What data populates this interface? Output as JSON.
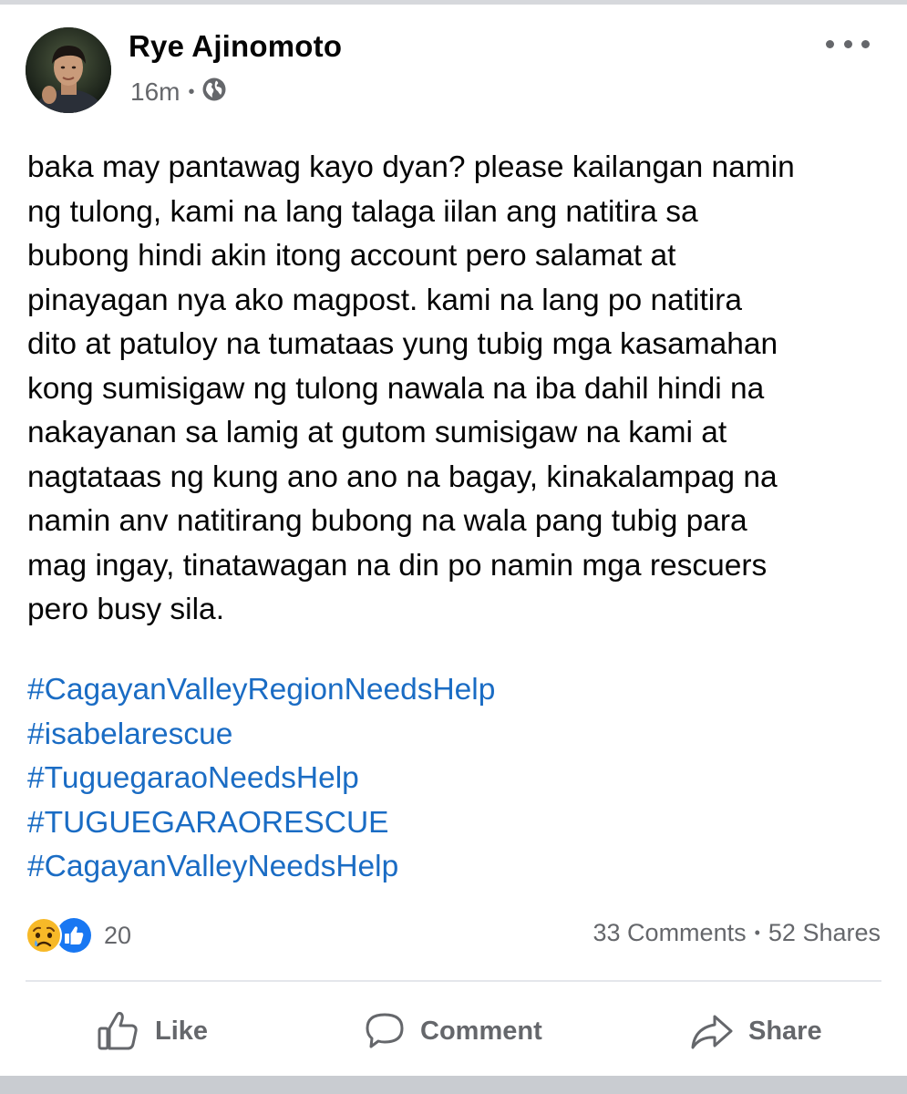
{
  "post": {
    "author": "Rye Ajinomoto",
    "time": "16m",
    "separator": "•",
    "privacy_icon": "globe-icon",
    "text_lines": [
      "baka may pantawag kayo dyan? please kailangan namin",
      "ng tulong, kami na lang talaga iilan ang natitira sa",
      "bubong hindi akin itong account pero salamat at",
      "pinayagan nya ako magpost. kami na lang po natitira",
      "dito at patuloy na tumataas yung tubig mga kasamahan",
      "kong sumisigaw ng tulong nawala na iba dahil hindi na",
      "nakayanan sa lamig at gutom sumisigaw na kami at",
      "nagtataas ng kung ano ano na bagay, kinakalampag na",
      "namin anv natitirang bubong na wala pang tubig para",
      "mag ingay, tinatawagan na din po namin mga rescuers",
      "pero busy sila."
    ],
    "hashtags": [
      "#CagayanValleyRegionNeedsHelp",
      "#isabelarescue",
      "#TuguegaraoNeedsHelp",
      "#TUGUEGARAORESCUE",
      "#CagayanValleyNeedsHelp"
    ]
  },
  "engagement": {
    "reaction_count": "20",
    "reaction_icons": [
      "sad-icon",
      "like-icon"
    ],
    "comments": "33 Comments",
    "shares": "52 Shares",
    "separator": "•"
  },
  "actions": {
    "like": "Like",
    "comment": "Comment",
    "share": "Share"
  },
  "colors": {
    "hashtag": "#1a6cc4",
    "secondary_text": "#65676b",
    "like_blue": "#1877f2",
    "sad_yellow": "#f7b928"
  }
}
